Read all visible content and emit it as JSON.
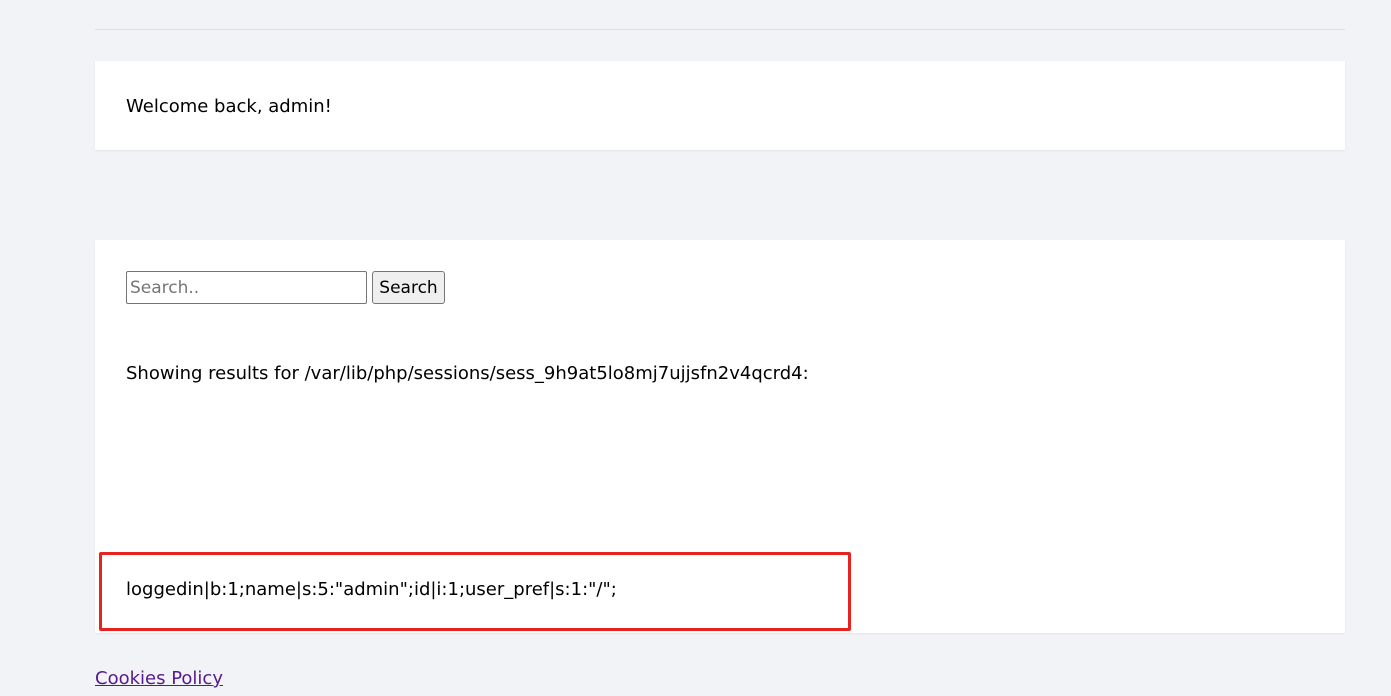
{
  "welcome": {
    "message": "Welcome back, admin!"
  },
  "search": {
    "placeholder": "Search..",
    "value": "",
    "button_label": "Search",
    "results_label": "Showing results for /var/lib/php/sessions/sess_9h9at5lo8mj7ujjsfn2v4qcrd4:",
    "output": "loggedin|b:1;name|s:5:\"admin\";id|i:1;user_pref|s:1:\"/\";"
  },
  "annotation": {
    "highlight_color": "#e8231f"
  },
  "footer": {
    "cookies_link": "Cookies Policy",
    "link_color": "#551a8b"
  },
  "colors": {
    "page_background": "#f2f3f7",
    "card_background": "#ffffff"
  }
}
